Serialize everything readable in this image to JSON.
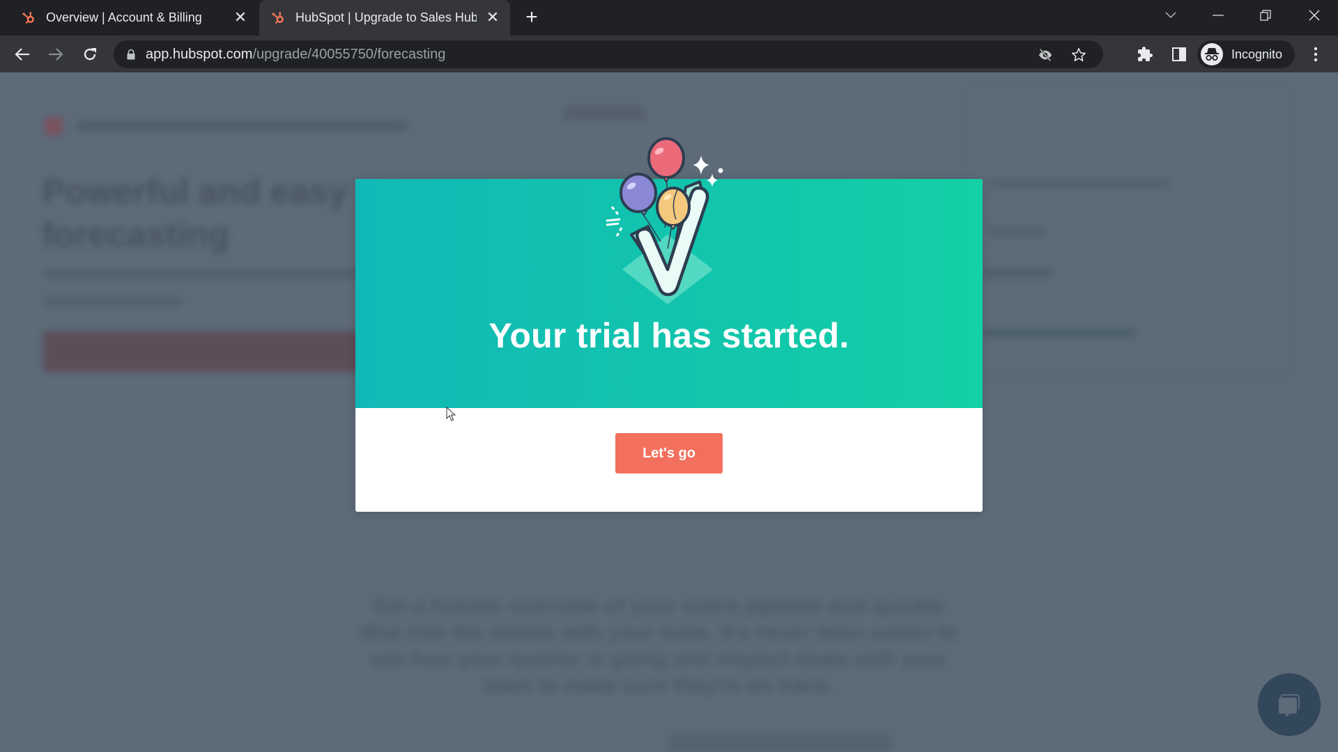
{
  "browser": {
    "tabs": [
      {
        "title": "Overview | Account & Billing",
        "favicon": "hubspot-sprocket-icon",
        "active": false
      },
      {
        "title": "HubSpot | Upgrade to Sales Hub",
        "favicon": "hubspot-sprocket-icon",
        "active": true
      }
    ],
    "new_tab_label": "+",
    "address": {
      "host": "app.hubspot.com",
      "path": "/upgrade/40055750/forecasting"
    },
    "profile_label": "Incognito",
    "window_controls": [
      "tab-search-icon",
      "minimize-icon",
      "restore-icon",
      "close-icon"
    ],
    "toolbar_icons": [
      "back-icon",
      "forward-icon",
      "reload-icon",
      "lock-icon",
      "eye-off-icon",
      "star-icon",
      "extensions-icon",
      "side-panel-icon",
      "incognito-icon",
      "more-menu-icon"
    ]
  },
  "background_page": {
    "heading": "Powerful and easy\nforecasting",
    "paragraph": "Get a holistic overview of your entire pipeline and quickly dive into the details with your team. It's never been easier to see how your quarter is going and inspect deals with your team to make sure they're on track."
  },
  "modal": {
    "title": "Your trial has started.",
    "cta_label": "Let's go",
    "illustration": "balloons-checkmark-illustration",
    "colors": {
      "hero_gradient_start": "#11b9b6",
      "hero_gradient_end": "#13d0a5",
      "cta": "#f2705d"
    }
  },
  "chat": {
    "icon": "chat-bubble-icon"
  }
}
